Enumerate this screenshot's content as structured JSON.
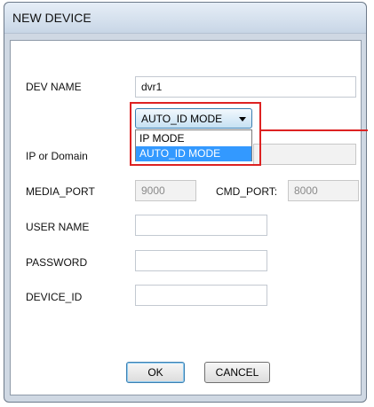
{
  "window": {
    "title": "NEW DEVICE"
  },
  "form": {
    "dev_name_label": "DEV NAME",
    "dev_name_value": "dvr1",
    "mode_select_value": "AUTO_ID MODE",
    "mode_options": [
      "IP MODE",
      "AUTO_ID MODE"
    ],
    "ip_domain_label": "IP or Domain",
    "ip_domain_value": "",
    "media_port_label": "MEDIA_PORT",
    "media_port_value": "9000",
    "cmd_port_label": "CMD_PORT:",
    "cmd_port_value": "8000",
    "user_name_label": "USER NAME",
    "user_name_value": "",
    "password_label": "PASSWORD",
    "password_value": "",
    "device_id_label": "DEVICE_ID",
    "device_id_value": ""
  },
  "buttons": {
    "ok": "OK",
    "cancel": "CANCEL"
  },
  "colors": {
    "highlight": "#dd2222",
    "selection": "#3399ff"
  }
}
